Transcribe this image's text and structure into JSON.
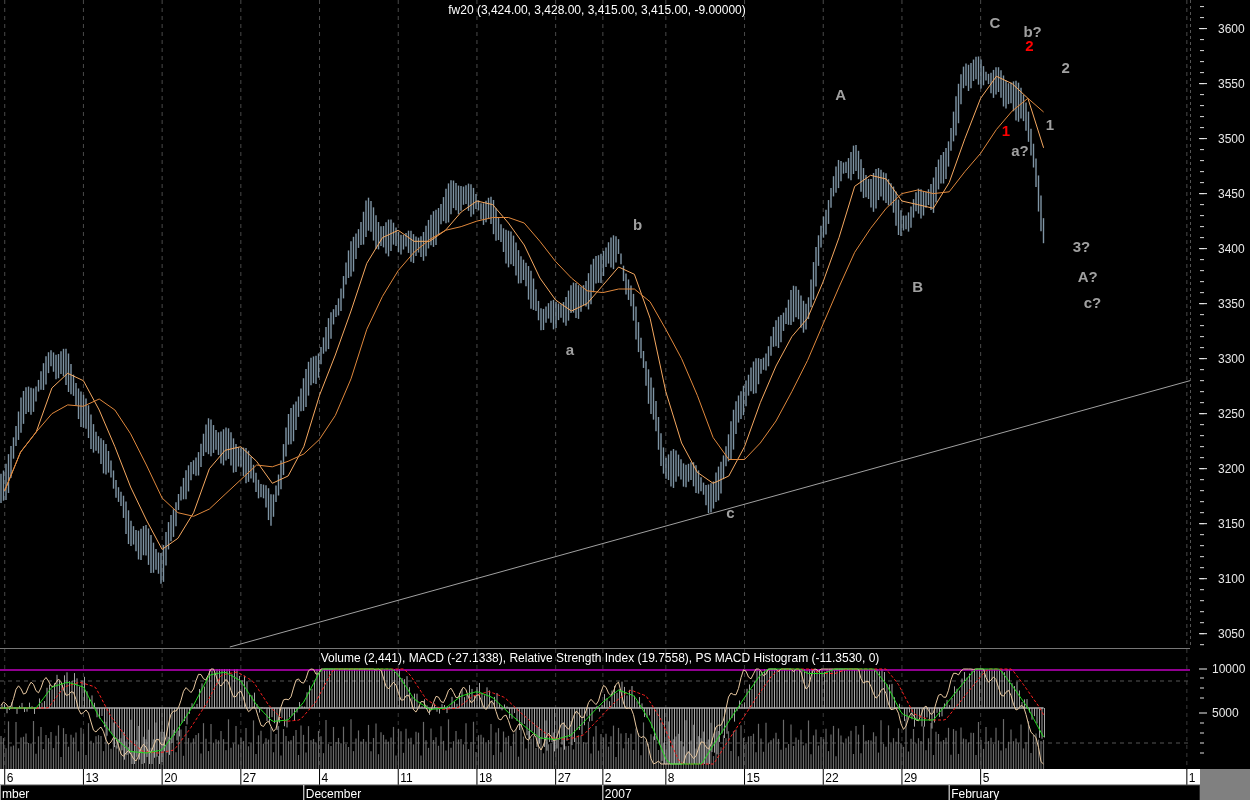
{
  "price_chart": {
    "title": "fw20 (3,424.00, 3,428.00, 3,415.00, 3,415.00, -9.00000)",
    "axis_labels": [
      "3600",
      "3550",
      "3500",
      "3450",
      "3400",
      "3350",
      "3300",
      "3250",
      "3200",
      "3150",
      "3100",
      "3050"
    ],
    "wave_labels": [
      {
        "text": "C",
        "color": "#a0a0a0"
      },
      {
        "text": "b?",
        "color": "#a0a0a0"
      },
      {
        "text": "2",
        "color": "#ff0000"
      },
      {
        "text": "2",
        "color": "#a0a0a0"
      },
      {
        "text": "A",
        "color": "#a0a0a0"
      },
      {
        "text": "1",
        "color": "#ff0000"
      },
      {
        "text": "1",
        "color": "#a0a0a0"
      },
      {
        "text": "a?",
        "color": "#a0a0a0"
      },
      {
        "text": "b",
        "color": "#a0a0a0"
      },
      {
        "text": "3?",
        "color": "#a0a0a0"
      },
      {
        "text": "A?",
        "color": "#a0a0a0"
      },
      {
        "text": "B",
        "color": "#a0a0a0"
      },
      {
        "text": "c?",
        "color": "#a0a0a0"
      },
      {
        "text": "a",
        "color": "#a0a0a0"
      },
      {
        "text": "c",
        "color": "#a0a0a0"
      }
    ]
  },
  "indicator_panel": {
    "title": "Volume (2,441), MACD (-27.1338), Relative Strength Index (19.7558), PS MACD Histogram (-11.3530, 0)",
    "axis_labels": [
      "10000",
      "5000"
    ]
  },
  "date_axis": {
    "days": [
      "6",
      "13",
      "20",
      "27",
      "4",
      "11",
      "18",
      "27",
      "2",
      "8",
      "15",
      "22",
      "29",
      "5",
      "1"
    ],
    "months": [
      "mber",
      "December",
      "2007",
      "February"
    ]
  }
}
